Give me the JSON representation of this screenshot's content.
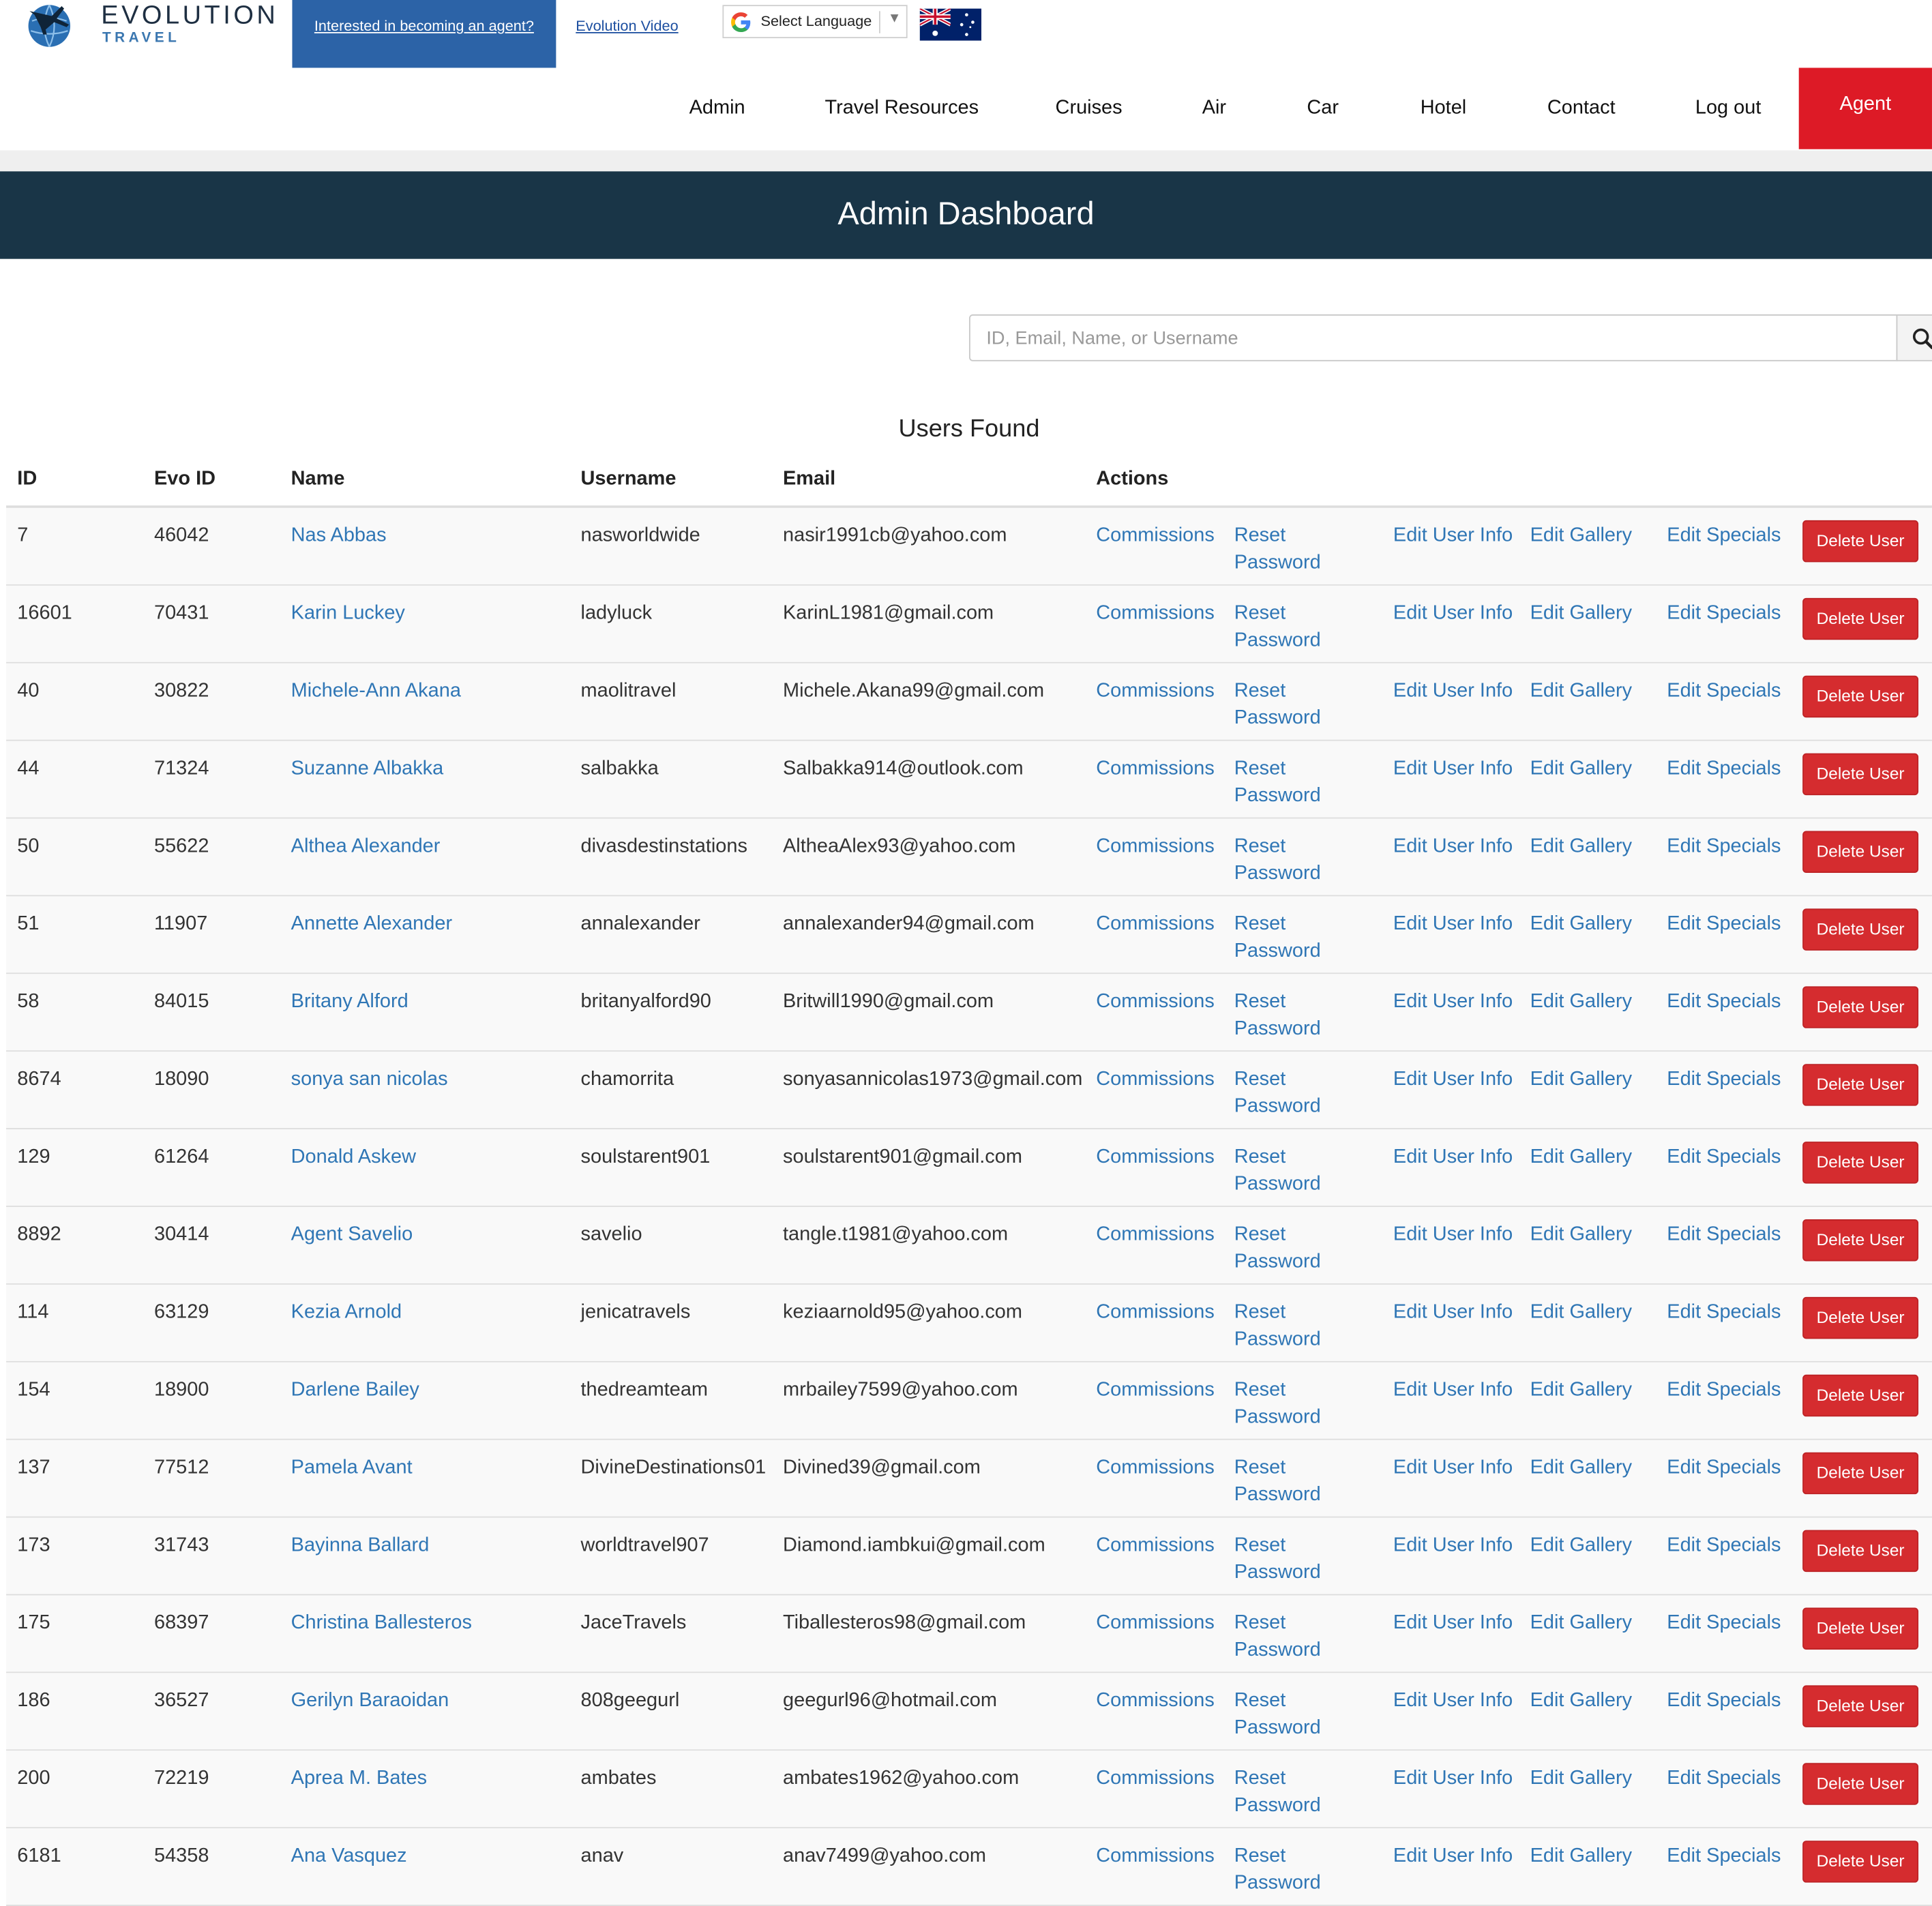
{
  "header": {
    "logo_word": "EVOLUTION",
    "logo_sub": "TRAVEL",
    "become_agent_link": "Interested in becoming an agent?",
    "video_link": "Evolution Video",
    "language_select": "Select Language",
    "flag_icon": "australia-flag-icon"
  },
  "nav": {
    "items": [
      {
        "label": "Admin"
      },
      {
        "label": "Travel Resources"
      },
      {
        "label": "Cruises"
      },
      {
        "label": "Air"
      },
      {
        "label": "Car"
      },
      {
        "label": "Hotel"
      },
      {
        "label": "Contact"
      },
      {
        "label": "Log out"
      }
    ],
    "agent_button": "Agent"
  },
  "banner": {
    "title": "Admin Dashboard"
  },
  "search": {
    "placeholder": "ID, Email, Name, or Username",
    "value": "",
    "icon": "search-icon"
  },
  "results_title": "Users Found",
  "table": {
    "headers": [
      "ID",
      "Evo ID",
      "Name",
      "Username",
      "Email",
      "Actions"
    ],
    "actions": {
      "commissions": "Commissions",
      "reset_password": "Reset Password",
      "edit_user_info": "Edit User Info",
      "edit_gallery": "Edit Gallery",
      "edit_specials": "Edit Specials",
      "delete_user": "Delete User"
    },
    "rows": [
      {
        "id": "7",
        "evo_id": "46042",
        "name": "Nas Abbas",
        "username": "nasworldwide",
        "email": "nasir1991cb@yahoo.com"
      },
      {
        "id": "16601",
        "evo_id": "70431",
        "name": "Karin Luckey",
        "username": "ladyluck",
        "email": "KarinL1981@gmail.com"
      },
      {
        "id": "40",
        "evo_id": "30822",
        "name": "Michele-Ann Akana",
        "username": "maolitravel",
        "email": "Michele.Akana99@gmail.com"
      },
      {
        "id": "44",
        "evo_id": "71324",
        "name": "Suzanne Albakka",
        "username": "salbakka",
        "email": "Salbakka914@outlook.com"
      },
      {
        "id": "50",
        "evo_id": "55622",
        "name": "Althea Alexander",
        "username": "divasdestinstations",
        "email": "AltheaAlex93@yahoo.com"
      },
      {
        "id": "51",
        "evo_id": "11907",
        "name": "Annette Alexander",
        "username": "annalexander",
        "email": "annalexander94@gmail.com"
      },
      {
        "id": "58",
        "evo_id": "84015",
        "name": "Britany Alford",
        "username": "britanyalford90",
        "email": "Britwill1990@gmail.com"
      },
      {
        "id": "8674",
        "evo_id": "18090",
        "name": "sonya san nicolas",
        "username": "chamorrita",
        "email": "sonyasannicolas1973@gmail.com"
      },
      {
        "id": "129",
        "evo_id": "61264",
        "name": "Donald Askew",
        "username": "soulstarent901",
        "email": "soulstarent901@gmail.com"
      },
      {
        "id": "8892",
        "evo_id": "30414",
        "name": "Agent Savelio",
        "username": "savelio",
        "email": "tangle.t1981@yahoo.com"
      },
      {
        "id": "114",
        "evo_id": "63129",
        "name": "Kezia Arnold",
        "username": "jenicatravels",
        "email": "keziaarnold95@yahoo.com"
      },
      {
        "id": "154",
        "evo_id": "18900",
        "name": "Darlene Bailey",
        "username": "thedreamteam",
        "email": "mrbailey7599@yahoo.com"
      },
      {
        "id": "137",
        "evo_id": "77512",
        "name": "Pamela Avant",
        "username": "DivineDestinations01",
        "email": "Divined39@gmail.com"
      },
      {
        "id": "173",
        "evo_id": "31743",
        "name": "Bayinna Ballard",
        "username": "worldtravel907",
        "email": "Diamond.iambkui@gmail.com"
      },
      {
        "id": "175",
        "evo_id": "68397",
        "name": "Christina Ballesteros",
        "username": "JaceTravels",
        "email": "Tiballesteros98@gmail.com"
      },
      {
        "id": "186",
        "evo_id": "36527",
        "name": "Gerilyn Baraoidan",
        "username": "808geegurl",
        "email": "geegurl96@hotmail.com"
      },
      {
        "id": "200",
        "evo_id": "72219",
        "name": "Aprea M. Bates",
        "username": "ambates",
        "email": "ambates1962@yahoo.com"
      },
      {
        "id": "6181",
        "evo_id": "54358",
        "name": "Ana Vasquez",
        "username": "anav",
        "email": "anav7499@yahoo.com"
      }
    ]
  }
}
